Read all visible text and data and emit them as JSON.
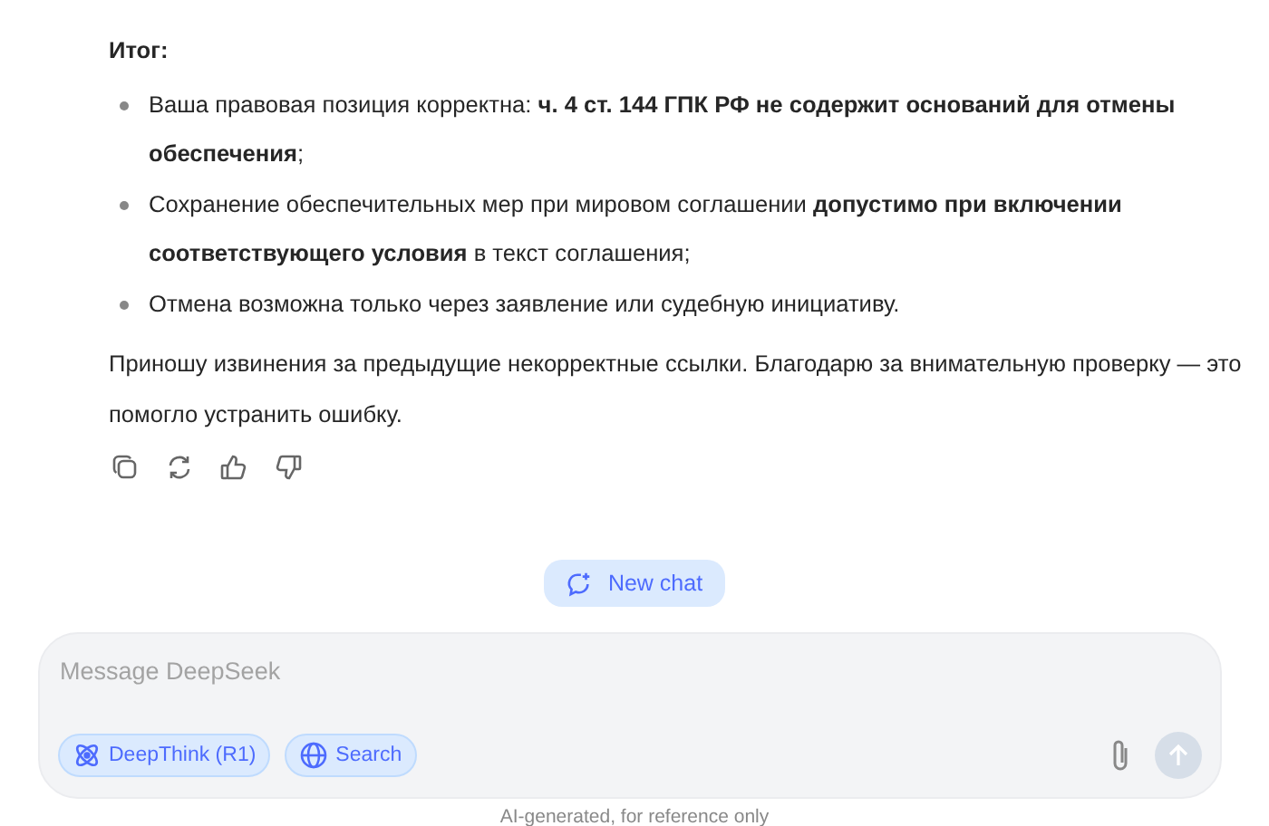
{
  "message": {
    "heading": "Итог:",
    "bullets": [
      "Ваша правовая позиция корректна: **ч. 4 ст. 144 ГПК РФ не содержит оснований для отмены обеспечения**;",
      "Сохранение обеспечительных мер при мировом соглашении **допустимо при включении соответствующего условия** в текст соглашения;",
      "Отмена возможна только через заявление или судебную инициативу."
    ],
    "paragraph": "Приношу извинения за предыдущие некорректные ссылки. Благодарю за внимательную проверку — это помогло устранить ошибку."
  },
  "actions": [
    {
      "kind": "copy"
    },
    {
      "kind": "regenerate"
    },
    {
      "kind": "like"
    },
    {
      "kind": "dislike"
    }
  ],
  "new_chat": {
    "label": "New chat"
  },
  "composer": {
    "placeholder": "Message DeepSeek",
    "toggles": [
      {
        "kind": "deepthink",
        "label": "DeepThink (R1)",
        "selected": true
      },
      {
        "kind": "search",
        "label": "Search",
        "selected": true
      }
    ],
    "send_disabled": true
  },
  "footer": "AI-generated, for reference only"
}
